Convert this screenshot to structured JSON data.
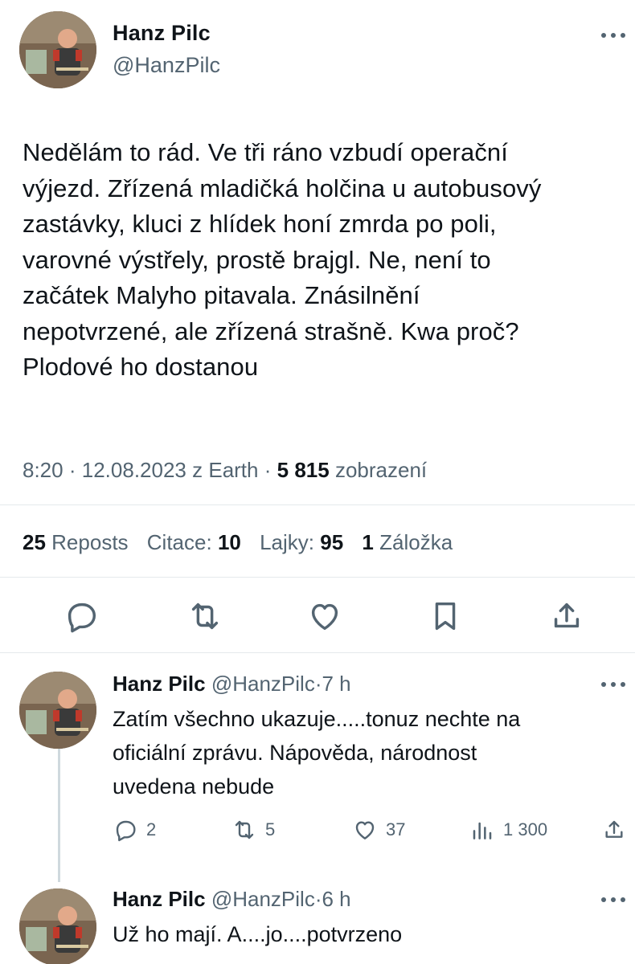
{
  "colors": {
    "text": "#0f1419",
    "secondary": "#536471",
    "divider": "#e5e9ec",
    "thread_line": "#cfd9de"
  },
  "main_tweet": {
    "author_name": "Hanz Pilc",
    "author_handle": "@HanzPilc",
    "text_lines": [
      "Nedělám to rád. Ve tři ráno vzbudí operační",
      "výjezd. Zřízená mladičká holčina u autobusový",
      "zastávky, kluci z hlídek honí zmrda po poli,",
      "varovné výstřely, prostě brajgl. Ne, není to",
      "začátek Malyho pitavala. Znásilnění",
      "nepotvrzené, ale zřízená strašně. Kwa proč?",
      "Plodové ho dostanou"
    ],
    "time": "8:20",
    "date": "12.08.2023",
    "source": "z Earth",
    "views_count": "5 815",
    "views_label": "zobrazení",
    "stats": {
      "reposts_count": "25",
      "reposts_label": "Reposts",
      "quotes_label": "Citace:",
      "quotes_count": "10",
      "likes_label": "Lajky:",
      "likes_count": "95",
      "bookmarks_count": "1",
      "bookmarks_label": "Záložka"
    },
    "actions": [
      "reply-icon",
      "repost-icon",
      "like-icon",
      "bookmark-icon",
      "share-icon"
    ]
  },
  "replies": [
    {
      "author_name": "Hanz Pilc",
      "author_handle": "@HanzPilc",
      "time": "7 h",
      "text_lines": [
        "Zatím všechno ukazuje.....tonuz nechte na",
        "oficiální zprávu. Nápověda, národnost",
        "uvedena nebude"
      ],
      "reply_count": "2",
      "repost_count": "5",
      "like_count": "37",
      "view_count": "1 300"
    },
    {
      "author_name": "Hanz Pilc",
      "author_handle": "@HanzPilc",
      "time": "6 h",
      "text_lines": [
        "Už ho mají. A....jo....potvrzeno"
      ]
    }
  ]
}
